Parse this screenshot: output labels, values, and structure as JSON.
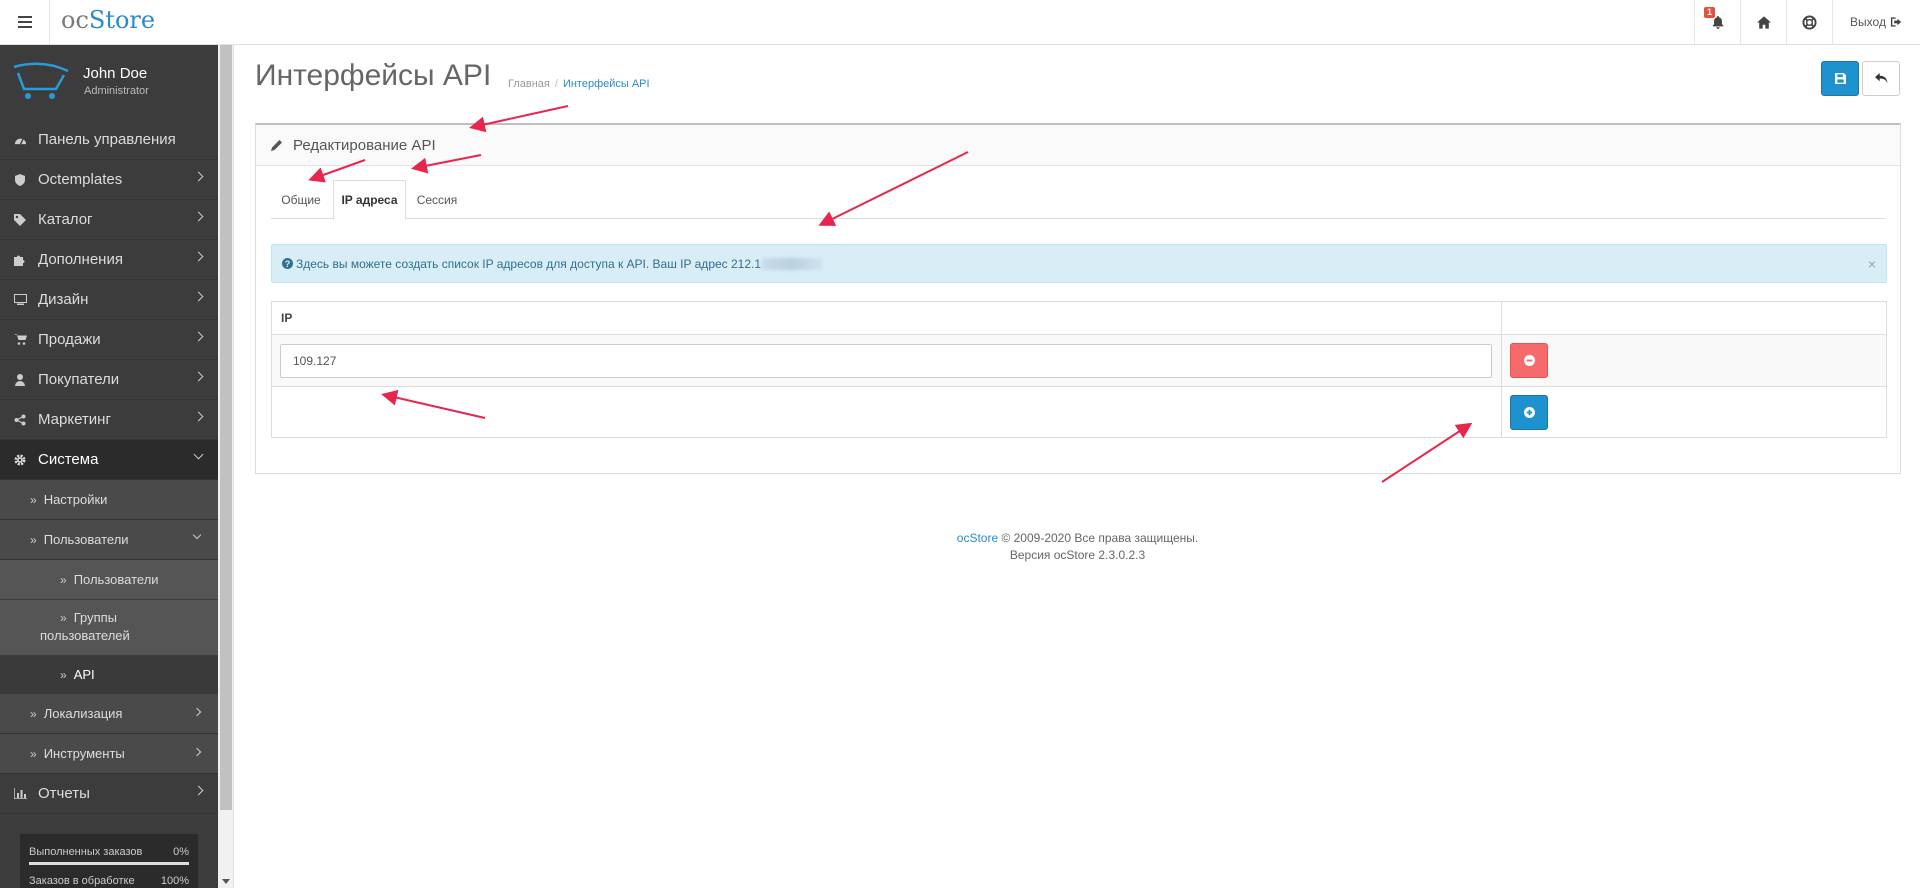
{
  "header": {
    "logo_oc": "oc",
    "logo_store": "Store",
    "notification_count": "1",
    "logout_label": "Выход"
  },
  "user": {
    "name": "John Doe",
    "role": "Administrator"
  },
  "sidebar": {
    "items": [
      {
        "label": "Панель управления",
        "icon": "dashboard-icon"
      },
      {
        "label": "Octemplates",
        "icon": "shield-icon"
      },
      {
        "label": "Каталог",
        "icon": "tags-icon"
      },
      {
        "label": "Дополнения",
        "icon": "puzzle-icon"
      },
      {
        "label": "Дизайн",
        "icon": "monitor-icon"
      },
      {
        "label": "Продажи",
        "icon": "cart-icon"
      },
      {
        "label": "Покупатели",
        "icon": "user-icon"
      },
      {
        "label": "Маркетинг",
        "icon": "share-icon"
      },
      {
        "label": "Система",
        "icon": "gear-icon"
      }
    ],
    "system_sub": [
      "Настройки",
      "Пользователи",
      "Локализация",
      "Инструменты"
    ],
    "users_sub": [
      "Пользователи",
      "Группы",
      "пользователей",
      "API"
    ],
    "reports": "Отчеты",
    "stats": [
      {
        "label": "Выполненных заказов",
        "value": "0%",
        "fill": 1.0
      },
      {
        "label": "Заказов в обработке",
        "value": "100%"
      }
    ]
  },
  "page": {
    "title": "Интерфейсы API",
    "breadcrumb": [
      "Главная",
      "/",
      "Интерфейсы API"
    ]
  },
  "panel": {
    "heading": "Редактирование API",
    "tabs": [
      "Общие",
      "IP адреса",
      "Сессия"
    ],
    "active_tab": "IP адреса",
    "alert": "Здесь вы можете создать список IP адресов для доступа к API. Ваш IP адрес 212.1",
    "alert_close": "×",
    "table_header": "IP",
    "ip_value": "109.127"
  },
  "footer": {
    "link": "ocStore",
    "copyright": " © 2009-2020 Все права защищены.",
    "version": "Версия ocStore 2.3.0.2.3"
  },
  "colors": {
    "primary": "#1e91cf",
    "danger": "#f56b6b",
    "sidebar": "#3c3c3c",
    "annotation_arrow": "#e8264d"
  }
}
